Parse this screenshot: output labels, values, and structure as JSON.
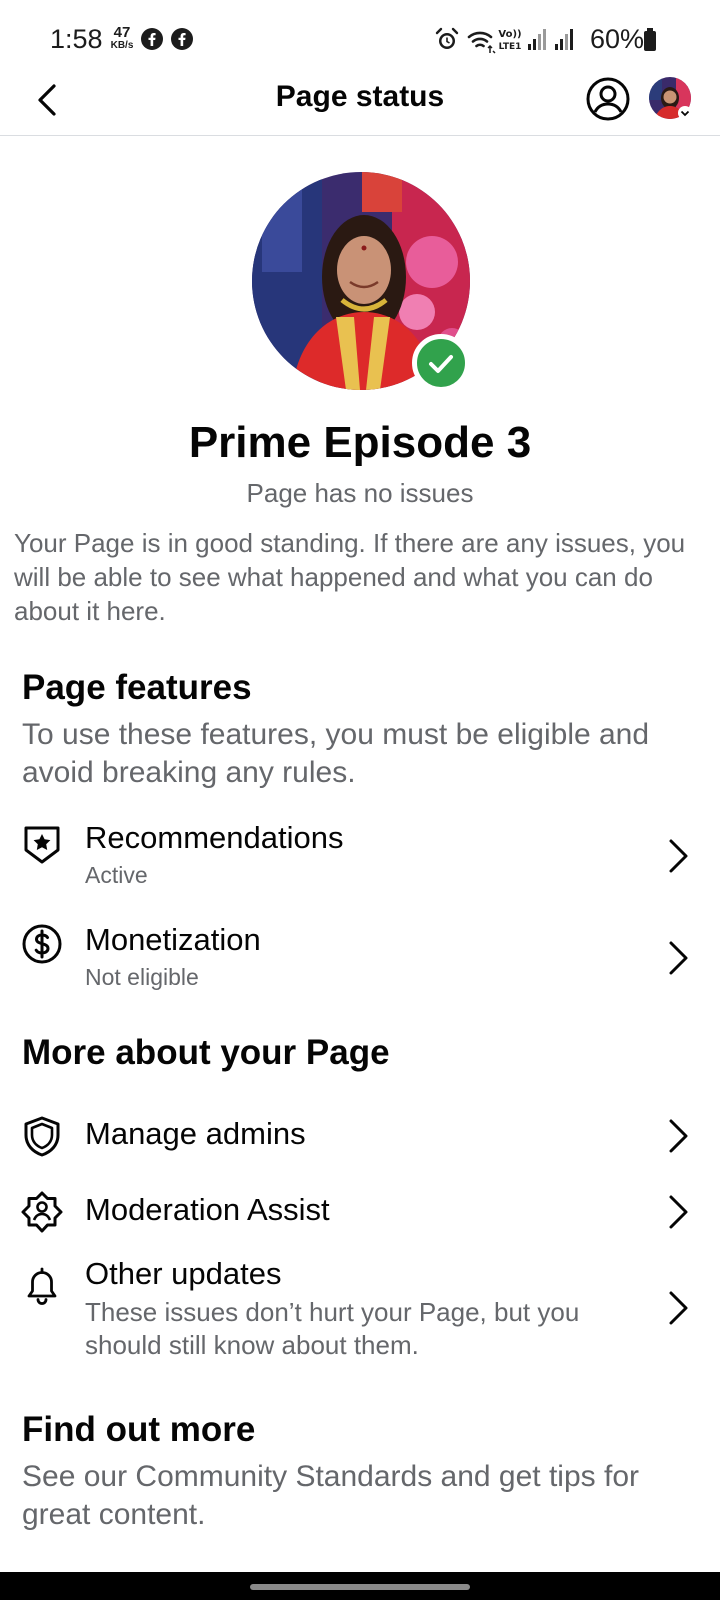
{
  "status_bar": {
    "time": "1:58",
    "net_speed": "47",
    "net_unit": "KB/s",
    "battery": "60%",
    "icons": [
      "facebook-icon",
      "facebook-icon",
      "alarm-icon",
      "wifi-icon",
      "volte-icon",
      "signal-icon",
      "signal-icon",
      "battery-icon"
    ]
  },
  "header": {
    "title": "Page status"
  },
  "profile": {
    "name": "Prime Episode 3",
    "state": "Page has no issues",
    "standing_text": "Your Page is in good standing. If there are any issues, you will be able to see what happened and what you can do about it here."
  },
  "page_features": {
    "title": "Page features",
    "description": "To use these features, you must be eligible and avoid breaking any rules.",
    "items": [
      {
        "icon": "shield-star-icon",
        "label": "Recommendations",
        "status": "Active"
      },
      {
        "icon": "dollar-circle-icon",
        "label": "Monetization",
        "status": "Not eligible"
      }
    ]
  },
  "more_about": {
    "title": "More about your Page",
    "items": [
      {
        "icon": "shield-icon",
        "label": "Manage admins"
      },
      {
        "icon": "moderation-icon",
        "label": "Moderation Assist"
      },
      {
        "icon": "bell-icon",
        "label": "Other updates",
        "description": "These issues don’t hurt your Page, but you should still know about them."
      }
    ]
  },
  "find_out_more": {
    "title": "Find out more",
    "description": "See our Community Standards and get tips for great content."
  },
  "colors": {
    "verified_green": "#31a24c",
    "secondary_text": "#65676b",
    "primary_text": "#050505",
    "divider": "#dadde1"
  }
}
